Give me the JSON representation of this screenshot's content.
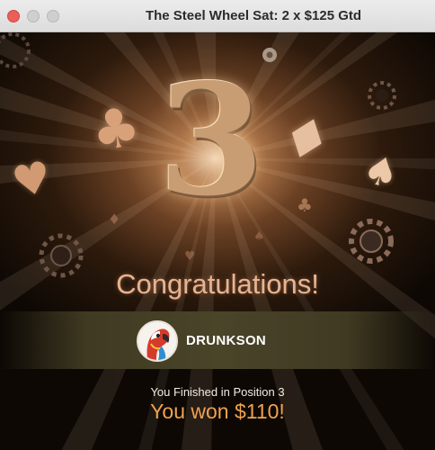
{
  "window": {
    "title": "The Steel Wheel Sat: 2 x $125 Gtd"
  },
  "result": {
    "position_digit": "3",
    "congrats": "Congratulations!",
    "player_name": "DRUNKSON",
    "finished_text": "You Finished in Position 3",
    "won_text": "You won $110!"
  },
  "decorations": {
    "suits": [
      "♣",
      "♦",
      "♥",
      "♠"
    ]
  },
  "colors": {
    "gold": "#c99d73",
    "prize": "#f0a24e",
    "close_button": "#ec5e58"
  }
}
